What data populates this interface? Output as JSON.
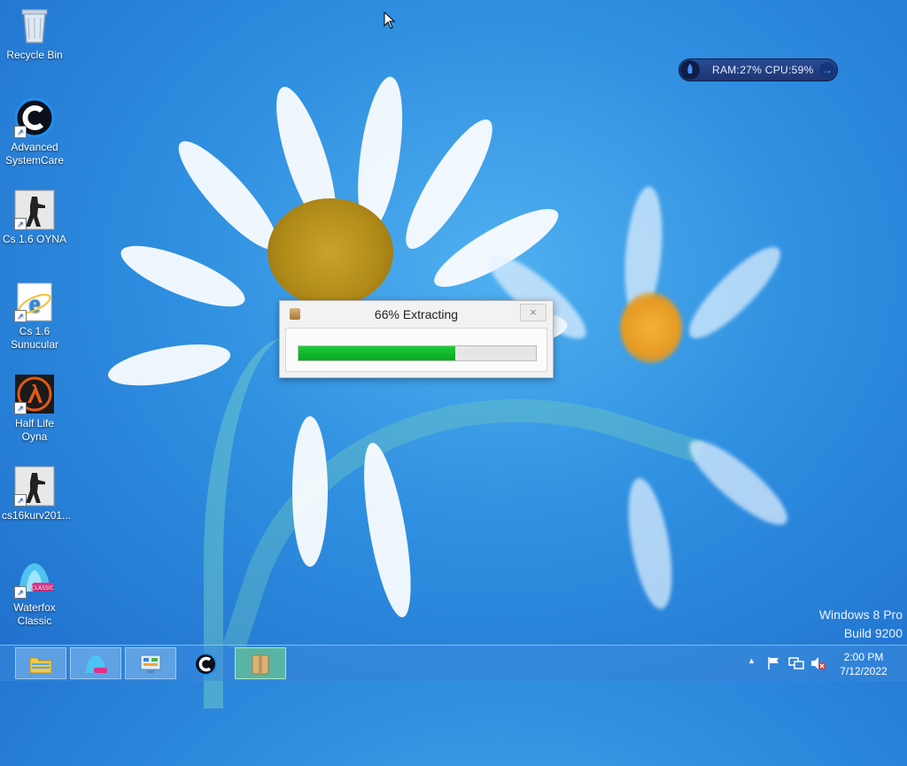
{
  "desktop": {
    "icons": [
      {
        "label": "Recycle Bin",
        "icon": "recycle-bin-icon"
      },
      {
        "label": "Advanced SystemCare",
        "icon": "advanced-systemcare-icon"
      },
      {
        "label": "Cs 1.6 OYNA",
        "icon": "counter-strike-icon"
      },
      {
        "label": "Cs 1.6 Sunucular",
        "icon": "internet-explorer-icon"
      },
      {
        "label": "Half Life Oyna",
        "icon": "half-life-icon"
      },
      {
        "label": "cs16kurv201...",
        "icon": "counter-strike-icon"
      },
      {
        "label": "Waterfox Classic",
        "icon": "waterfox-icon"
      }
    ]
  },
  "gadget": {
    "text": "RAM:27%  CPU:59%"
  },
  "dialog": {
    "title": "66% Extracting",
    "close_label": "×",
    "progress": 0.66
  },
  "watermark": {
    "line1": "Windows 8 Pro",
    "line2": "Build 9200"
  },
  "taskbar": {
    "buttons": [
      {
        "name": "file-explorer",
        "icon": "folder-icon"
      },
      {
        "name": "waterfox",
        "icon": "waterfox-icon"
      },
      {
        "name": "control-panel",
        "icon": "control-panel-icon"
      },
      {
        "name": "advanced-systemcare",
        "icon": "advanced-systemcare-icon"
      },
      {
        "name": "extractor",
        "icon": "archive-icon"
      }
    ],
    "tray": {
      "show_hidden_label": "▲",
      "time": "2:00 PM",
      "date": "7/12/2022"
    }
  },
  "colors": {
    "progress_fill": "#06a81f",
    "gadget_bg": "#1c356f",
    "taskbar_active": "#78dc78"
  }
}
